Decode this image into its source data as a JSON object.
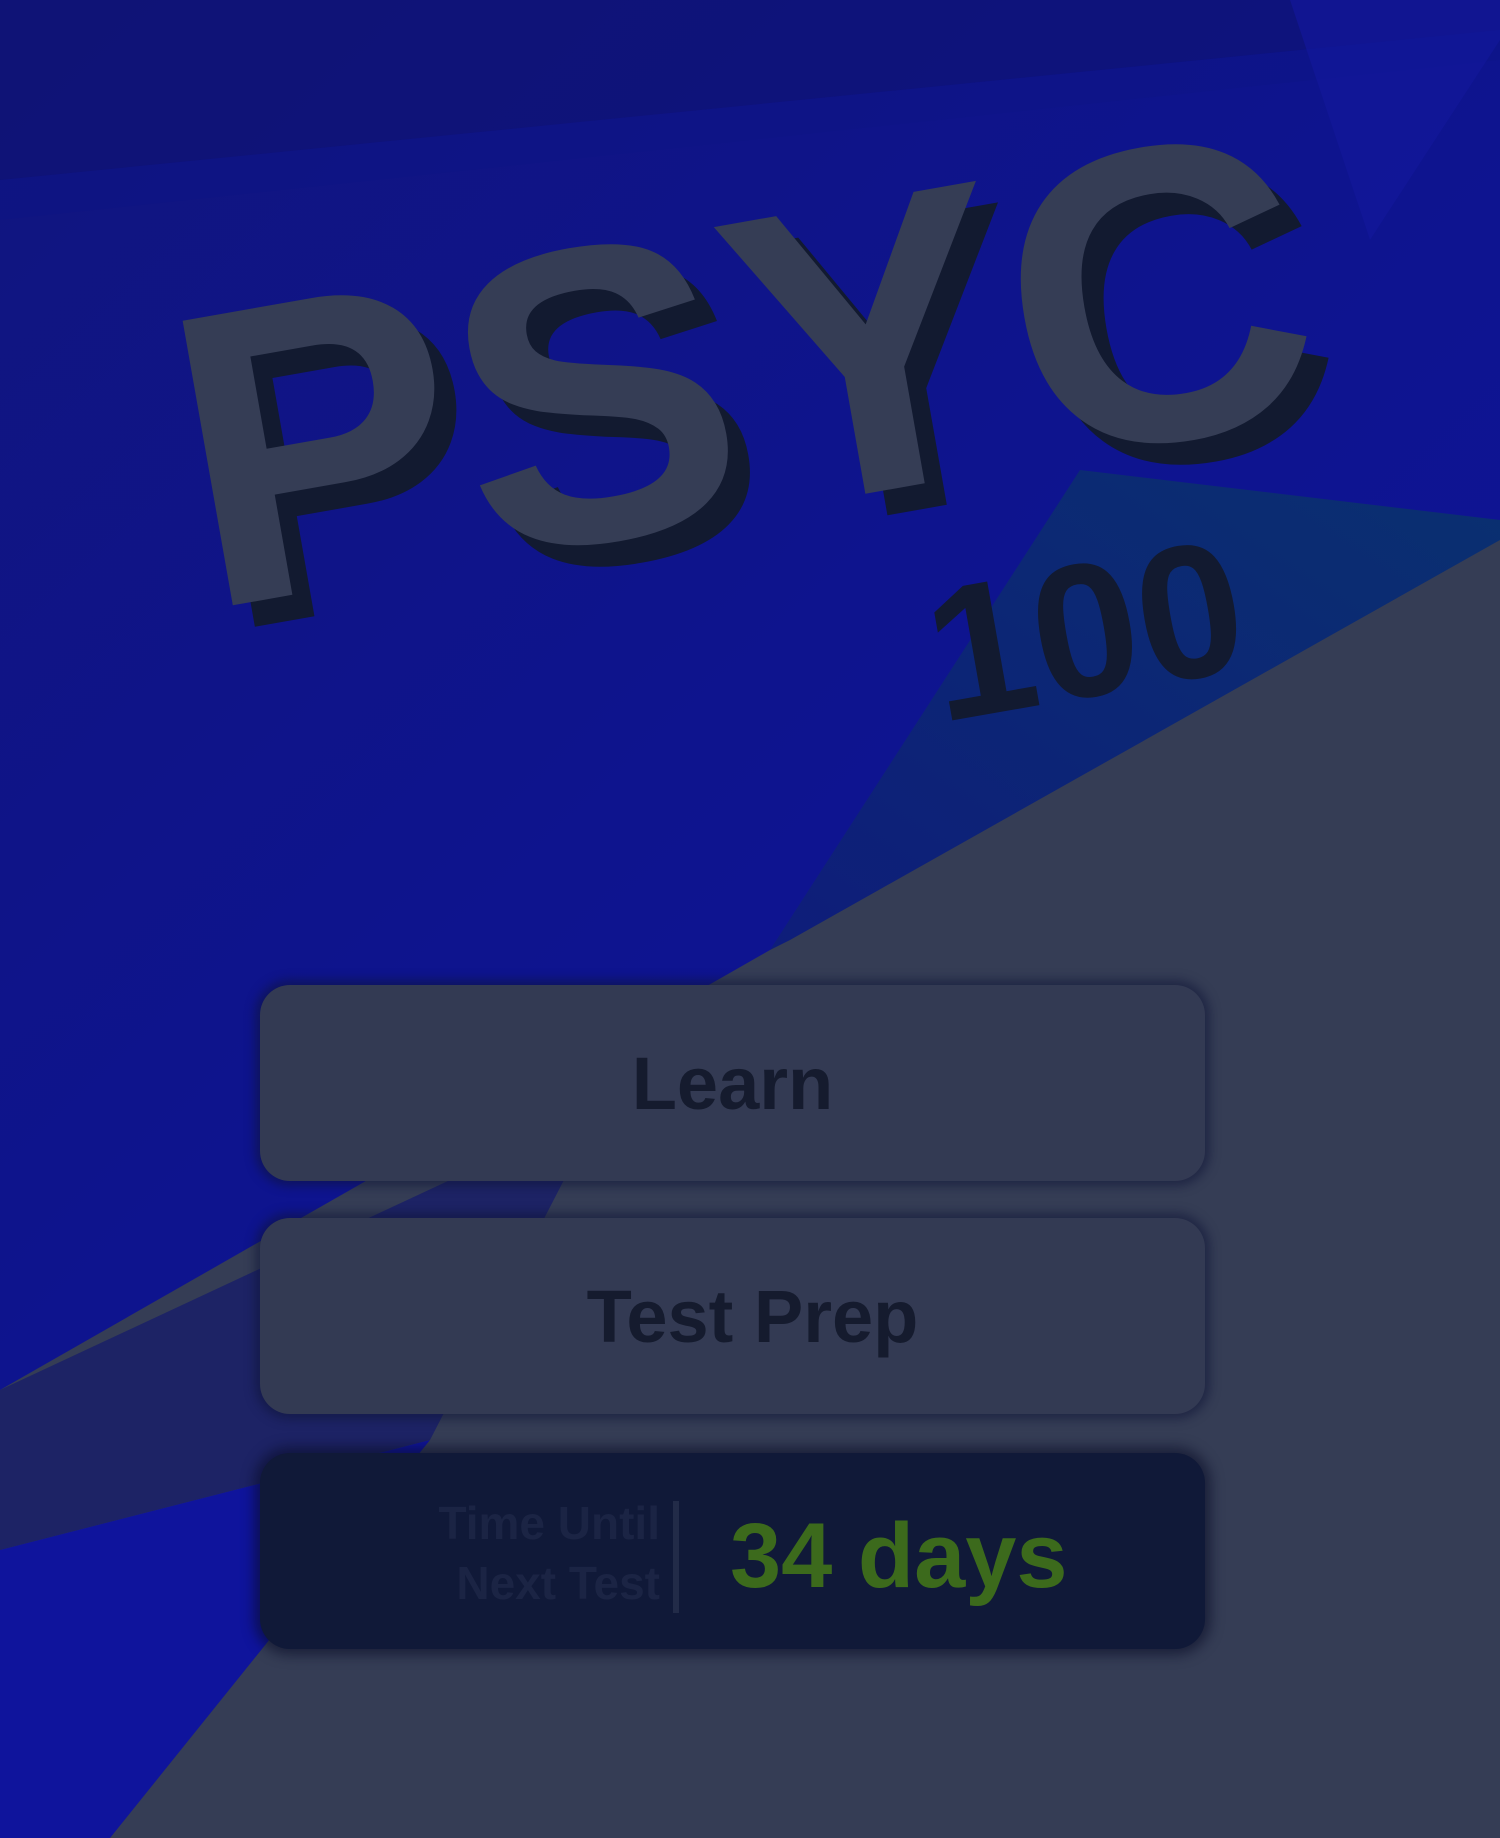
{
  "app": {
    "logo": {
      "title": "PSYC",
      "number": "100"
    }
  },
  "menu": {
    "learn_label": "Learn",
    "test_prep_label": "Test Prep"
  },
  "countdown": {
    "label_line1": "Time Until",
    "label_line2": "Next Test",
    "value": "34 days"
  },
  "colors": {
    "background_dark_blue": "#0f158a",
    "background_slate": "#353d55",
    "accent_teal_blue": "#0b2a6a",
    "button_fill": "#333a53",
    "countdown_fill": "#101938",
    "countdown_value": "#3c6a1c"
  }
}
